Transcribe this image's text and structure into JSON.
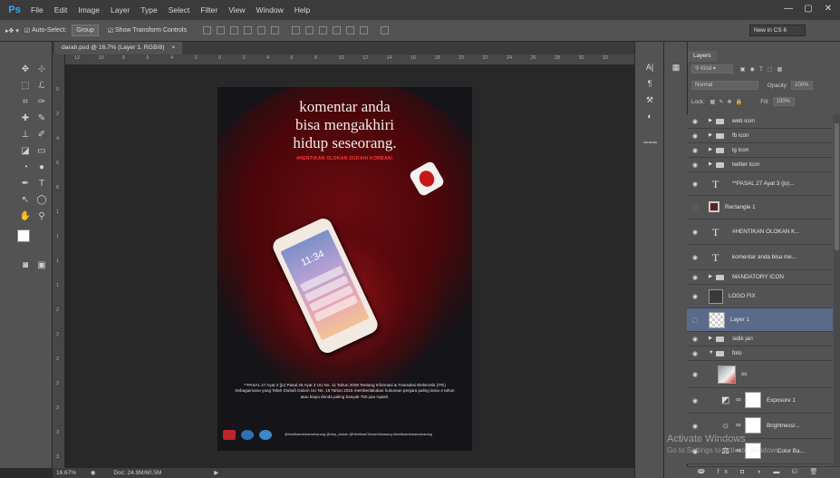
{
  "app": {
    "logo": "Ps"
  },
  "menu": [
    "File",
    "Edit",
    "Image",
    "Layer",
    "Type",
    "Select",
    "Filter",
    "View",
    "Window",
    "Help"
  ],
  "window_controls": [
    "—",
    "▢",
    "✕"
  ],
  "options": {
    "auto_select_label": "Auto-Select:",
    "auto_select_value": "Group",
    "show_transform_label": "Show Transform Controls",
    "workspace": "New in CS 6"
  },
  "document": {
    "tab_title": "darah.psd @ 16.7% (Layer 1, RGB/8)",
    "tab_close": "×",
    "zoom": "16.67%",
    "doc_size": "Doc: 24.9M/60.5M"
  },
  "ruler_h_ticks": [
    "12",
    "10",
    "8",
    "6",
    "4",
    "2",
    "0",
    "2",
    "4",
    "6",
    "8",
    "10",
    "12",
    "14",
    "16",
    "18",
    "20",
    "22",
    "24",
    "26",
    "28",
    "30",
    "32"
  ],
  "ruler_v_ticks": [
    "0",
    "2",
    "4",
    "6",
    "8",
    "1",
    "1",
    "1",
    "1",
    "2",
    "2",
    "2",
    "2",
    "3",
    "3",
    "3"
  ],
  "poster": {
    "headline": [
      "komentar anda",
      "bisa mengakhiri",
      "hidup seseorang."
    ],
    "hashtag": "#HENTIKAN OLOKAN SUDAHI KORBAN!",
    "phone_time": "11:34",
    "legal": "**PASAL 27 Ayat 3 (jo) Pasal 45 Ayat 3 UU No. 11 Tahun 2008 Tentang Informasi & Transaksi Elektronik (ITE) Sebagaimana yang Telah Diubah Dalam UU No. 19 Tahun 2016 memberlakukan hukuman penjara paling lama 4 tahun atau biaya denda paling banyak 750 juta rupiah.",
    "social": "@hentikanolokansekarang  @stop_olokan  @HentikanOlokanSekarang  #hentikanolokansekarang",
    "logo_colors": [
      "#c0242c",
      "#2f6fb5",
      "#3d86c9"
    ]
  },
  "layers_panel": {
    "title": "Layers",
    "kind_label": "Kind",
    "blend_mode": "Normal",
    "opacity_label": "Opacity:",
    "opacity_value": "100%",
    "lock_label": "Lock:",
    "fill_label": "Fill:",
    "fill_value": "100%",
    "layers": [
      {
        "name": "web icon",
        "type": "folder"
      },
      {
        "name": "fb icon",
        "type": "folder"
      },
      {
        "name": "ig icon",
        "type": "folder"
      },
      {
        "name": "twitter icon",
        "type": "folder"
      },
      {
        "name": "**PASAL 27 Ayat 3 (jo)...",
        "type": "text"
      },
      {
        "name": "Rectangle 1",
        "type": "shape"
      },
      {
        "name": "#HENTIKAN OLOKAN K...",
        "type": "text"
      },
      {
        "name": "komentar anda bisa me...",
        "type": "text"
      },
      {
        "name": "MANDATORY ICON",
        "type": "folder"
      },
      {
        "name": "LOGO FIX",
        "type": "smart"
      },
      {
        "name": "Layer 1",
        "type": "pixel",
        "selected": true
      },
      {
        "name": "sidik jari",
        "type": "folder"
      },
      {
        "name": "foto",
        "type": "folder-open"
      },
      {
        "name": "ss",
        "type": "pixel"
      },
      {
        "name": "Exposure 1",
        "type": "adjustment"
      },
      {
        "name": "Brightness/...",
        "type": "adjustment"
      },
      {
        "name": "Color Ba...",
        "type": "adjustment"
      }
    ],
    "footer_icons": "ↈ fx ◘ ◑ ▬ ◱ 🗑"
  },
  "watermark": {
    "line1": "Activate Windows",
    "line2": "Go to Settings to activate Windows."
  }
}
